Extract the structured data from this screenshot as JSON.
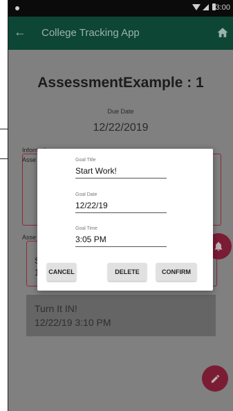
{
  "status_bar": {
    "time": "3:00"
  },
  "toolbar": {
    "title": "College Tracking App",
    "back_icon": "arrow-left-icon",
    "home_icon": "home-icon"
  },
  "assessment": {
    "title": "AssessmentExample : 1",
    "due_label": "Due Date",
    "due_value": "12/22/2019"
  },
  "information": {
    "label": "Information",
    "text": "Asse"
  },
  "assessment_box": {
    "label": "Asse",
    "line1": "S",
    "line2": "1"
  },
  "goal_card": {
    "title": "Turn It IN!",
    "datetime": "12/22/19 3:10 PM"
  },
  "dialog": {
    "goal_title_label": "Goal Title",
    "goal_title_value": "Start Work!",
    "goal_date_label": "Goal Date",
    "goal_date_value": "12/22/19",
    "goal_time_label": "Goal Time",
    "goal_time_value": "3:05 PM",
    "cancel_label": "CANCEL",
    "delete_label": "DELETE",
    "confirm_label": "CONFIRM"
  },
  "colors": {
    "toolbar": "#0d4634",
    "accent": "#7b1c35",
    "scrim": "#808080"
  }
}
